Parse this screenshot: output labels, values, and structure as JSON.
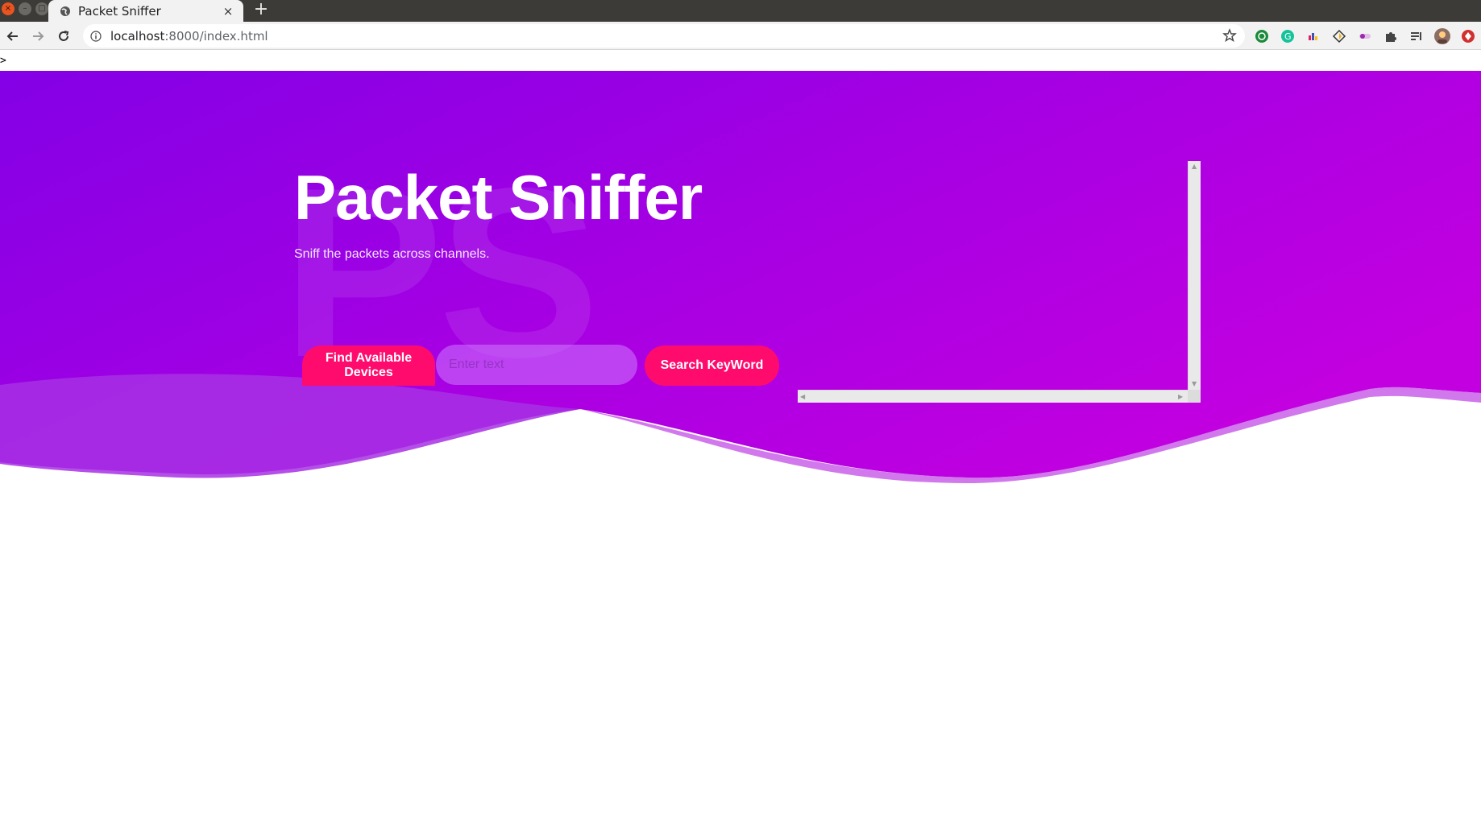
{
  "browser": {
    "tab_title": "Packet Sniffer",
    "tab_close": "×",
    "new_tab": "+",
    "url_host": "localhost",
    "url_path": ":8000/index.html"
  },
  "page": {
    "stray_text": ">",
    "watermark": "PS",
    "title": "Packet Sniffer",
    "subtitle": "Sniff the packets across channels.",
    "find_button": "Find Available Devices",
    "input_placeholder": "Enter text",
    "input_value": "",
    "search_button": "Search KeyWord",
    "output_text": ""
  },
  "colors": {
    "gradient_start": "#8400e6",
    "gradient_end": "#c200e0",
    "button": "#ff0b6e"
  },
  "toolbar": {
    "extensions": [
      "whatsapp-icon",
      "grammarly-icon",
      "color-bars-icon",
      "diamond-icon",
      "toggle-icon",
      "puzzle-icon",
      "media-queue-icon",
      "profile-avatar-icon",
      "record-icon"
    ]
  }
}
